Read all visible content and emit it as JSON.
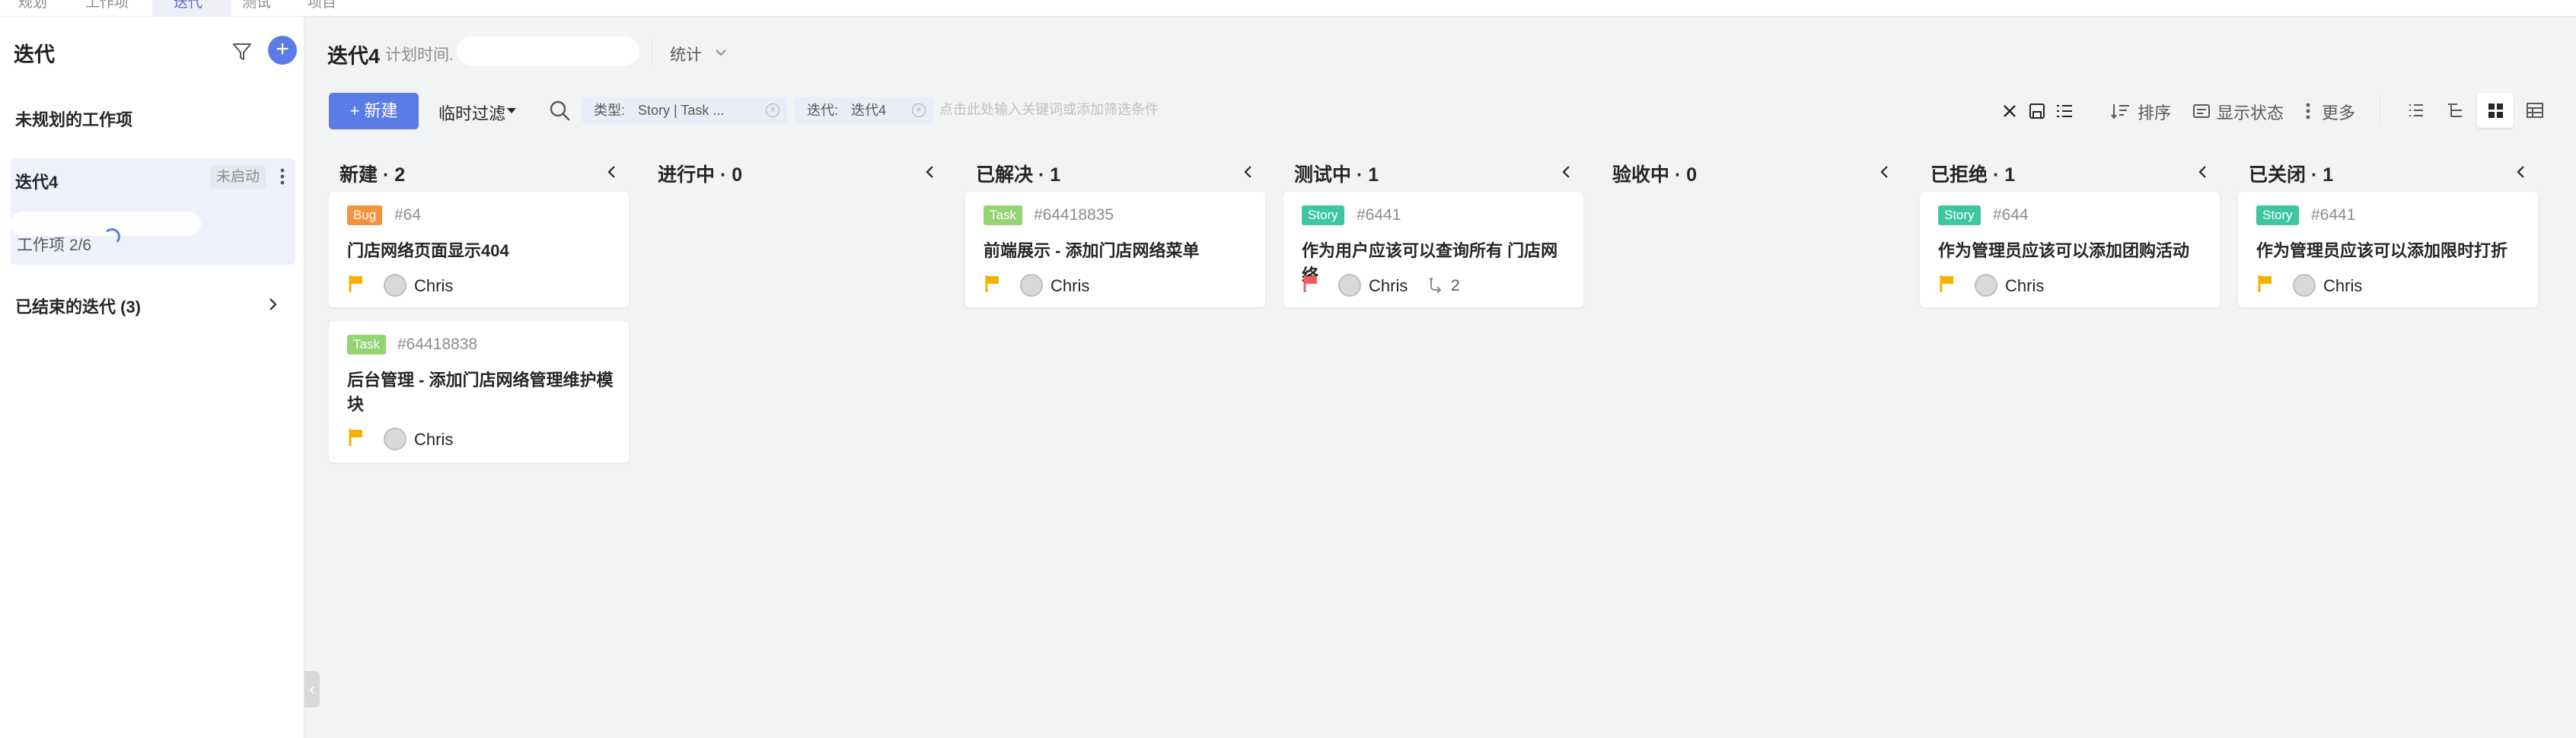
{
  "top_tabs": [
    "规划",
    "工作项",
    "迭代",
    "测试",
    "项目"
  ],
  "sidebar": {
    "title": "迭代",
    "unplanned": "未规划的工作项",
    "iteration": {
      "name": "迭代4",
      "status": "未启动",
      "count": "工作项 2/6"
    },
    "ended": "已结束的迭代 (3)"
  },
  "header": {
    "title": "迭代4",
    "plan_label": "计划时间.",
    "stats": "统计"
  },
  "toolbar": {
    "new_label": "+ 新建",
    "temp_filter": "临时过滤",
    "chips": [
      {
        "label": "类型:",
        "value": "Story  |  Task  ..."
      },
      {
        "label": "迭代:",
        "value": "迭代4"
      }
    ],
    "filter_placeholder": "点击此处输入关键词或添加筛选条件",
    "sort": "排序",
    "display": "显示状态",
    "more": "更多"
  },
  "colors": {
    "accent": "#5b7ce6",
    "bug": "#f5923e",
    "task": "#95d475",
    "story": "#3cc7a0",
    "flag_yellow": "#f5b100",
    "flag_red": "#f05a5a"
  },
  "columns": [
    {
      "title": "新建 · 2",
      "cards": [
        {
          "type": "Bug",
          "id": "#64",
          "title": "门店网络页面显示404",
          "flag": "yellow",
          "assignee": "Chris"
        },
        {
          "type": "Task",
          "id": "#64418838",
          "title": "后台管理 - 添加门店网络管理维护模块",
          "flag": "yellow",
          "assignee": "Chris"
        }
      ]
    },
    {
      "title": "进行中 · 0",
      "cards": []
    },
    {
      "title": "已解决 · 1",
      "cards": [
        {
          "type": "Task",
          "id": "#64418835",
          "title": "前端展示 - 添加门店网络菜单",
          "flag": "yellow",
          "assignee": "Chris"
        }
      ]
    },
    {
      "title": "测试中 · 1",
      "cards": [
        {
          "type": "Story",
          "id": "#6441",
          "title": "作为用户应该可以查询所有 门店网络",
          "flag": "red",
          "assignee": "Chris",
          "subtasks": "2"
        }
      ]
    },
    {
      "title": "验收中 · 0",
      "cards": []
    },
    {
      "title": "已拒绝 · 1",
      "cards": [
        {
          "type": "Story",
          "id": "#644",
          "title": "作为管理员应该可以添加团购活动",
          "flag": "yellow",
          "assignee": "Chris"
        }
      ]
    },
    {
      "title": "已关闭 · 1",
      "cards": [
        {
          "type": "Story",
          "id": "#6441",
          "title": "作为管理员应该可以添加限时打折",
          "flag": "yellow",
          "assignee": "Chris"
        }
      ]
    }
  ]
}
